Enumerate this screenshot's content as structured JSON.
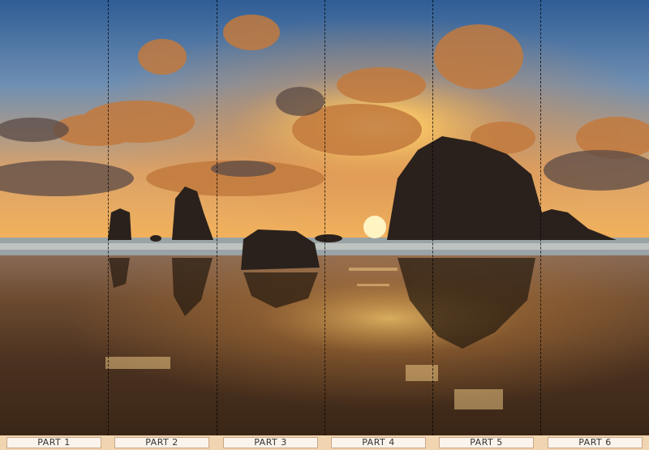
{
  "panels": [
    {
      "label": "PART 1"
    },
    {
      "label": "PART 2"
    },
    {
      "label": "PART 3"
    },
    {
      "label": "PART 4"
    },
    {
      "label": "PART 5"
    },
    {
      "label": "PART 6"
    }
  ],
  "colors": {
    "sky_top": "#2f5d95",
    "sky_glow": "#f4b25a",
    "sun": "#ffd36b",
    "rock": "#2a211c",
    "wet_sand": "#5a3b22",
    "label_bar": "#f1d4b0"
  }
}
